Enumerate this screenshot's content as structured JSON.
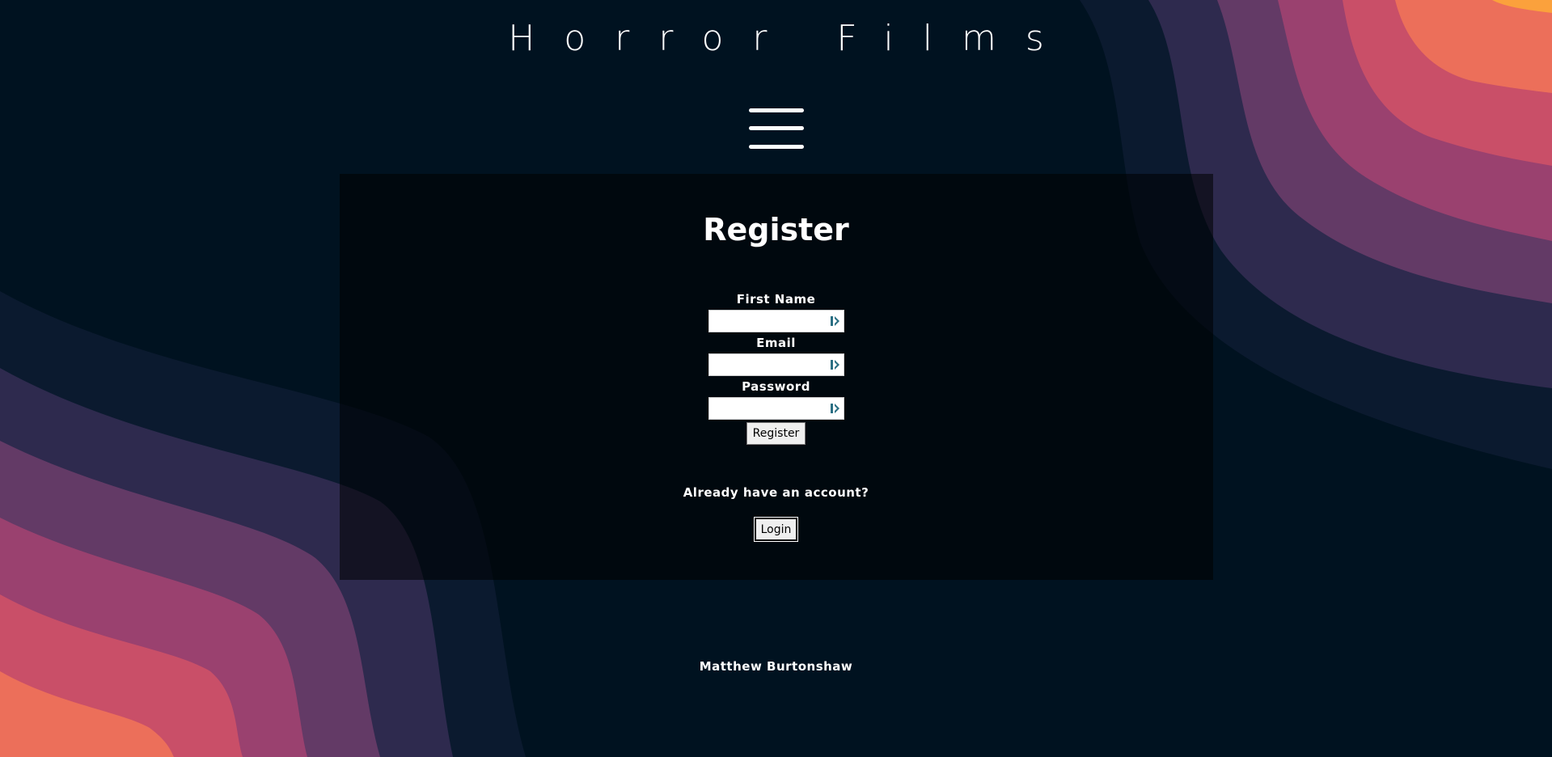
{
  "header": {
    "site_title": "Horror Films",
    "menu_icon": "hamburger-menu-icon"
  },
  "register_form": {
    "title": "Register",
    "fields": [
      {
        "label": "First Name",
        "value": "",
        "icon": "password-manager-key-icon"
      },
      {
        "label": "Email",
        "value": "",
        "icon": "password-manager-key-icon"
      },
      {
        "label": "Password",
        "value": "",
        "icon": "password-manager-key-icon"
      }
    ],
    "submit_label": "Register"
  },
  "login_prompt": {
    "text": "Already have an account?",
    "button_label": "Login"
  },
  "footer": {
    "author": "Matthew Burtonshaw"
  },
  "colors": {
    "background": "#001220",
    "wave_1": "#0b1a2f",
    "wave_2": "#2e2a4e",
    "wave_3": "#633a66",
    "wave_4": "#9a416f",
    "wave_5": "#c94f68",
    "wave_6": "#ec6f5a",
    "wave_7": "#fba13c"
  }
}
